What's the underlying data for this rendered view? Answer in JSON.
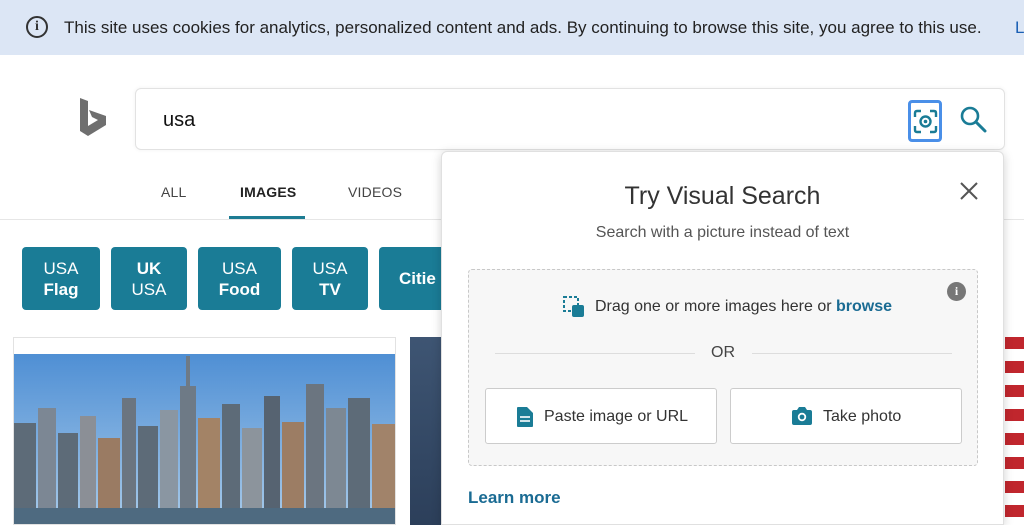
{
  "cookie_banner": {
    "info_icon_glyph": "i",
    "text": "This site uses cookies for analytics, personalized content and ads. By continuing to browse this site, you agree to this use.",
    "link": "L"
  },
  "search": {
    "query": "usa",
    "visual_search_icon": "visual-search-icon",
    "search_icon": "magnifier-icon"
  },
  "tabs": [
    {
      "label": "ALL",
      "active": false
    },
    {
      "label": "IMAGES",
      "active": true
    },
    {
      "label": "VIDEOS",
      "active": false
    }
  ],
  "chips": [
    {
      "line1": "USA",
      "line2": "Flag"
    },
    {
      "line1": "UK",
      "line2": "USA"
    },
    {
      "line1": "USA",
      "line2": "Food"
    },
    {
      "line1": "USA",
      "line2": "TV"
    },
    {
      "line1": "Citie",
      "line2": ""
    }
  ],
  "popup": {
    "title": "Try Visual Search",
    "subtitle": "Search with a picture instead of text",
    "drop_text": "Drag one or more images here or",
    "browse_link": "browse",
    "info_glyph": "i",
    "or_text": "OR",
    "paste_button": "Paste image or URL",
    "photo_button": "Take photo",
    "learn_more": "Learn more"
  },
  "colors": {
    "accent": "#1a7c96",
    "link": "#1a6b93",
    "banner": "#dce6f5"
  }
}
